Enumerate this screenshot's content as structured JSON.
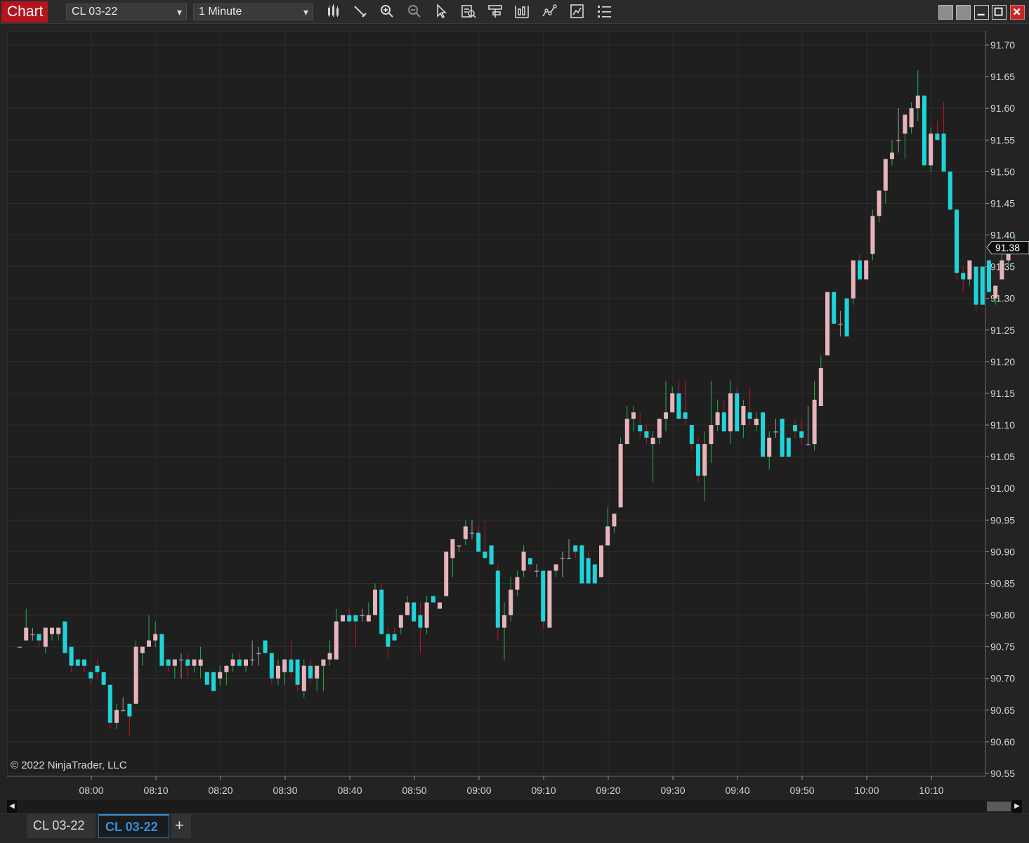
{
  "window": {
    "title": "Chart",
    "instrument": "CL 03-22",
    "interval": "1 Minute",
    "toolbar_icons": [
      "bars-type-icon",
      "drawing-tool-icon",
      "zoom-in-icon",
      "zoom-out-icon",
      "pointer-icon",
      "data-box-icon",
      "properties-icon",
      "strategies-icon",
      "indicators-icon",
      "templates-icon",
      "list-icon"
    ]
  },
  "copyright": "© 2022 NinjaTrader, LLC",
  "tabs": [
    {
      "label": "CL 03-22"
    },
    {
      "label": "CL 03-22"
    }
  ],
  "add_tab_label": "+",
  "colors": {
    "background": "#232323",
    "up_body": "#e8b4bc",
    "down_body": "#1ed4d8",
    "up_wick": "#22b14c",
    "down_wick": "#c0161e",
    "neutral_wick": "#9a9a9a",
    "grid": "#2e2e2e"
  },
  "chart_data": {
    "type": "candlestick",
    "symbol": "CL 03-22",
    "interval": "1 Minute",
    "y_axis": {
      "min": 90.55,
      "max": 91.7,
      "ticks": [
        "90.55",
        "90.60",
        "90.65",
        "90.70",
        "90.75",
        "90.80",
        "90.85",
        "90.90",
        "90.95",
        "91.00",
        "91.05",
        "91.10",
        "91.15",
        "91.20",
        "91.25",
        "91.30",
        "91.35",
        "91.40",
        "91.45",
        "91.50",
        "91.55",
        "91.60",
        "91.65",
        "91.70"
      ]
    },
    "x_axis": {
      "labels": [
        "08:00",
        "08:10",
        "08:20",
        "08:30",
        "08:40",
        "08:50",
        "09:00",
        "09:10",
        "09:20",
        "09:30",
        "09:40",
        "09:50",
        "10:00",
        "10:10"
      ]
    },
    "last_price": "91.38",
    "grid": true,
    "candles": [
      {
        "o": 90.75,
        "h": 90.75,
        "l": 90.75,
        "c": 90.75
      },
      {
        "o": 90.76,
        "h": 90.81,
        "l": 90.76,
        "c": 90.78
      },
      {
        "o": 90.77,
        "h": 90.78,
        "l": 90.76,
        "c": 90.77
      },
      {
        "o": 90.77,
        "h": 90.77,
        "l": 90.75,
        "c": 90.76
      },
      {
        "o": 90.75,
        "h": 90.78,
        "l": 90.74,
        "c": 90.78
      },
      {
        "o": 90.77,
        "h": 90.78,
        "l": 90.76,
        "c": 90.78
      },
      {
        "o": 90.77,
        "h": 90.78,
        "l": 90.76,
        "c": 90.78
      },
      {
        "o": 90.79,
        "h": 90.79,
        "l": 90.74,
        "c": 90.74
      },
      {
        "o": 90.75,
        "h": 90.75,
        "l": 90.71,
        "c": 90.72
      },
      {
        "o": 90.73,
        "h": 90.73,
        "l": 90.72,
        "c": 90.72
      },
      {
        "o": 90.73,
        "h": 90.73,
        "l": 90.71,
        "c": 90.72
      },
      {
        "o": 90.71,
        "h": 90.71,
        "l": 90.69,
        "c": 90.7
      },
      {
        "o": 90.72,
        "h": 90.73,
        "l": 90.7,
        "c": 90.71
      },
      {
        "o": 90.71,
        "h": 90.71,
        "l": 90.69,
        "c": 90.69
      },
      {
        "o": 90.69,
        "h": 90.69,
        "l": 90.62,
        "c": 90.63
      },
      {
        "o": 90.63,
        "h": 90.66,
        "l": 90.62,
        "c": 90.65
      },
      {
        "o": 90.65,
        "h": 90.67,
        "l": 90.65,
        "c": 90.65
      },
      {
        "o": 90.66,
        "h": 90.66,
        "l": 90.61,
        "c": 90.64
      },
      {
        "o": 90.66,
        "h": 90.76,
        "l": 90.66,
        "c": 90.75
      },
      {
        "o": 90.74,
        "h": 90.75,
        "l": 90.72,
        "c": 90.75
      },
      {
        "o": 90.75,
        "h": 90.8,
        "l": 90.75,
        "c": 90.76
      },
      {
        "o": 90.76,
        "h": 90.79,
        "l": 90.75,
        "c": 90.77
      },
      {
        "o": 90.77,
        "h": 90.77,
        "l": 90.72,
        "c": 90.72
      },
      {
        "o": 90.73,
        "h": 90.73,
        "l": 90.71,
        "c": 90.72
      },
      {
        "o": 90.72,
        "h": 90.73,
        "l": 90.7,
        "c": 90.73
      },
      {
        "o": 90.73,
        "h": 90.74,
        "l": 90.7,
        "c": 90.73
      },
      {
        "o": 90.73,
        "h": 90.74,
        "l": 90.7,
        "c": 90.72
      },
      {
        "o": 90.72,
        "h": 90.73,
        "l": 90.71,
        "c": 90.73
      },
      {
        "o": 90.72,
        "h": 90.75,
        "l": 90.7,
        "c": 90.73
      },
      {
        "o": 90.71,
        "h": 90.71,
        "l": 90.69,
        "c": 90.69
      },
      {
        "o": 90.71,
        "h": 90.71,
        "l": 90.68,
        "c": 90.68
      },
      {
        "o": 90.7,
        "h": 90.72,
        "l": 90.69,
        "c": 90.71
      },
      {
        "o": 90.71,
        "h": 90.72,
        "l": 90.69,
        "c": 90.72
      },
      {
        "o": 90.72,
        "h": 90.74,
        "l": 90.71,
        "c": 90.73
      },
      {
        "o": 90.73,
        "h": 90.74,
        "l": 90.72,
        "c": 90.72
      },
      {
        "o": 90.72,
        "h": 90.73,
        "l": 90.71,
        "c": 90.73
      },
      {
        "o": 90.73,
        "h": 90.76,
        "l": 90.72,
        "c": 90.73
      },
      {
        "o": 90.74,
        "h": 90.75,
        "l": 90.72,
        "c": 90.74
      },
      {
        "o": 90.76,
        "h": 90.76,
        "l": 90.74,
        "c": 90.74
      },
      {
        "o": 90.74,
        "h": 90.74,
        "l": 90.69,
        "c": 90.7
      },
      {
        "o": 90.7,
        "h": 90.73,
        "l": 90.69,
        "c": 90.72
      },
      {
        "o": 90.71,
        "h": 90.73,
        "l": 90.69,
        "c": 90.73
      },
      {
        "o": 90.73,
        "h": 90.76,
        "l": 90.7,
        "c": 90.71
      },
      {
        "o": 90.73,
        "h": 90.73,
        "l": 90.68,
        "c": 90.69
      },
      {
        "o": 90.68,
        "h": 90.73,
        "l": 90.67,
        "c": 90.72
      },
      {
        "o": 90.72,
        "h": 90.73,
        "l": 90.69,
        "c": 90.7
      },
      {
        "o": 90.7,
        "h": 90.72,
        "l": 90.68,
        "c": 90.72
      },
      {
        "o": 90.72,
        "h": 90.73,
        "l": 90.68,
        "c": 90.73
      },
      {
        "o": 90.73,
        "h": 90.76,
        "l": 90.72,
        "c": 90.74
      },
      {
        "o": 90.73,
        "h": 90.81,
        "l": 90.73,
        "c": 90.79
      },
      {
        "o": 90.79,
        "h": 90.8,
        "l": 90.79,
        "c": 90.8
      },
      {
        "o": 90.8,
        "h": 90.81,
        "l": 90.79,
        "c": 90.79
      },
      {
        "o": 90.8,
        "h": 90.8,
        "l": 90.75,
        "c": 90.79
      },
      {
        "o": 90.8,
        "h": 90.81,
        "l": 90.79,
        "c": 90.8
      },
      {
        "o": 90.79,
        "h": 90.82,
        "l": 90.79,
        "c": 90.8
      },
      {
        "o": 90.8,
        "h": 90.85,
        "l": 90.8,
        "c": 90.84
      },
      {
        "o": 90.84,
        "h": 90.85,
        "l": 90.77,
        "c": 90.77
      },
      {
        "o": 90.77,
        "h": 90.78,
        "l": 90.73,
        "c": 90.75
      },
      {
        "o": 90.77,
        "h": 90.78,
        "l": 90.76,
        "c": 90.76
      },
      {
        "o": 90.78,
        "h": 90.8,
        "l": 90.77,
        "c": 90.8
      },
      {
        "o": 90.8,
        "h": 90.83,
        "l": 90.8,
        "c": 90.82
      },
      {
        "o": 90.82,
        "h": 90.82,
        "l": 90.79,
        "c": 90.79
      },
      {
        "o": 90.8,
        "h": 90.82,
        "l": 90.74,
        "c": 90.78
      },
      {
        "o": 90.78,
        "h": 90.83,
        "l": 90.77,
        "c": 90.82
      },
      {
        "o": 90.83,
        "h": 90.83,
        "l": 90.82,
        "c": 90.82
      },
      {
        "o": 90.81,
        "h": 90.82,
        "l": 90.81,
        "c": 90.82
      },
      {
        "o": 90.83,
        "h": 90.9,
        "l": 90.83,
        "c": 90.9
      },
      {
        "o": 90.89,
        "h": 90.91,
        "l": 90.86,
        "c": 90.92
      },
      {
        "o": 90.91,
        "h": 90.91,
        "l": 90.9,
        "c": 90.91
      },
      {
        "o": 90.92,
        "h": 90.95,
        "l": 90.91,
        "c": 90.94
      },
      {
        "o": 90.93,
        "h": 90.95,
        "l": 90.92,
        "c": 90.93
      },
      {
        "o": 90.93,
        "h": 90.94,
        "l": 90.9,
        "c": 90.9
      },
      {
        "o": 90.9,
        "h": 90.95,
        "l": 90.89,
        "c": 90.89
      },
      {
        "o": 90.91,
        "h": 90.91,
        "l": 90.88,
        "c": 90.88
      },
      {
        "o": 90.87,
        "h": 90.88,
        "l": 90.76,
        "c": 90.78
      },
      {
        "o": 90.78,
        "h": 90.82,
        "l": 90.73,
        "c": 90.8
      },
      {
        "o": 90.8,
        "h": 90.86,
        "l": 90.79,
        "c": 90.84
      },
      {
        "o": 90.84,
        "h": 90.87,
        "l": 90.83,
        "c": 90.86
      },
      {
        "o": 90.87,
        "h": 90.91,
        "l": 90.86,
        "c": 90.9
      },
      {
        "o": 90.89,
        "h": 90.89,
        "l": 90.87,
        "c": 90.88
      },
      {
        "o": 90.87,
        "h": 90.88,
        "l": 90.86,
        "c": 90.87
      },
      {
        "o": 90.87,
        "h": 90.87,
        "l": 90.78,
        "c": 90.79
      },
      {
        "o": 90.78,
        "h": 90.87,
        "l": 90.78,
        "c": 90.87
      },
      {
        "o": 90.87,
        "h": 90.88,
        "l": 90.86,
        "c": 90.88
      },
      {
        "o": 90.89,
        "h": 90.9,
        "l": 90.86,
        "c": 90.89
      },
      {
        "o": 90.89,
        "h": 90.92,
        "l": 90.89,
        "c": 90.89
      },
      {
        "o": 90.91,
        "h": 90.91,
        "l": 90.89,
        "c": 90.9
      },
      {
        "o": 90.91,
        "h": 90.91,
        "l": 90.85,
        "c": 90.85
      },
      {
        "o": 90.89,
        "h": 90.9,
        "l": 90.85,
        "c": 90.85
      },
      {
        "o": 90.88,
        "h": 90.88,
        "l": 90.85,
        "c": 90.85
      },
      {
        "o": 90.86,
        "h": 90.91,
        "l": 90.86,
        "c": 90.91
      },
      {
        "o": 90.91,
        "h": 90.97,
        "l": 90.91,
        "c": 90.94
      },
      {
        "o": 90.94,
        "h": 90.96,
        "l": 90.93,
        "c": 90.96
      },
      {
        "o": 90.97,
        "h": 91.08,
        "l": 90.97,
        "c": 91.07
      },
      {
        "o": 91.07,
        "h": 91.13,
        "l": 91.07,
        "c": 91.11
      },
      {
        "o": 91.11,
        "h": 91.13,
        "l": 91.09,
        "c": 91.12
      },
      {
        "o": 91.1,
        "h": 91.12,
        "l": 91.08,
        "c": 91.09
      },
      {
        "o": 91.09,
        "h": 91.1,
        "l": 91.07,
        "c": 91.08
      },
      {
        "o": 91.07,
        "h": 91.09,
        "l": 91.01,
        "c": 91.08
      },
      {
        "o": 91.08,
        "h": 91.1,
        "l": 91.07,
        "c": 91.11
      },
      {
        "o": 91.11,
        "h": 91.17,
        "l": 91.09,
        "c": 91.12
      },
      {
        "o": 91.12,
        "h": 91.16,
        "l": 91.12,
        "c": 91.15
      },
      {
        "o": 91.15,
        "h": 91.17,
        "l": 91.11,
        "c": 91.11
      },
      {
        "o": 91.12,
        "h": 91.17,
        "l": 91.1,
        "c": 91.11
      },
      {
        "o": 91.1,
        "h": 91.1,
        "l": 91.06,
        "c": 91.07
      },
      {
        "o": 91.07,
        "h": 91.08,
        "l": 91.01,
        "c": 91.02
      },
      {
        "o": 91.02,
        "h": 91.09,
        "l": 90.98,
        "c": 91.07
      },
      {
        "o": 91.07,
        "h": 91.17,
        "l": 91.04,
        "c": 91.1
      },
      {
        "o": 91.1,
        "h": 91.14,
        "l": 91.09,
        "c": 91.12
      },
      {
        "o": 91.12,
        "h": 91.14,
        "l": 91.09,
        "c": 91.09
      },
      {
        "o": 91.09,
        "h": 91.17,
        "l": 91.07,
        "c": 91.15
      },
      {
        "o": 91.15,
        "h": 91.16,
        "l": 91.09,
        "c": 91.09
      },
      {
        "o": 91.1,
        "h": 91.14,
        "l": 91.08,
        "c": 91.13
      },
      {
        "o": 91.12,
        "h": 91.16,
        "l": 91.1,
        "c": 91.11
      },
      {
        "o": 91.1,
        "h": 91.12,
        "l": 91.09,
        "c": 91.11
      },
      {
        "o": 91.12,
        "h": 91.12,
        "l": 91.05,
        "c": 91.05
      },
      {
        "o": 91.05,
        "h": 91.09,
        "l": 91.03,
        "c": 91.08
      },
      {
        "o": 91.09,
        "h": 91.11,
        "l": 91.08,
        "c": 91.09
      },
      {
        "o": 91.11,
        "h": 91.11,
        "l": 91.05,
        "c": 91.05
      },
      {
        "o": 91.08,
        "h": 91.08,
        "l": 91.05,
        "c": 91.05
      },
      {
        "o": 91.1,
        "h": 91.11,
        "l": 91.08,
        "c": 91.09
      },
      {
        "o": 91.09,
        "h": 91.11,
        "l": 91.07,
        "c": 91.08
      },
      {
        "o": 91.07,
        "h": 91.13,
        "l": 91.07,
        "c": 91.07
      },
      {
        "o": 91.07,
        "h": 91.17,
        "l": 91.06,
        "c": 91.14
      },
      {
        "o": 91.13,
        "h": 91.21,
        "l": 91.13,
        "c": 91.19
      },
      {
        "o": 91.21,
        "h": 91.31,
        "l": 91.21,
        "c": 91.31
      },
      {
        "o": 91.31,
        "h": 91.31,
        "l": 91.26,
        "c": 91.26
      },
      {
        "o": 91.26,
        "h": 91.28,
        "l": 91.24,
        "c": 91.26
      },
      {
        "o": 91.3,
        "h": 91.3,
        "l": 91.24,
        "c": 91.24
      },
      {
        "o": 91.3,
        "h": 91.36,
        "l": 91.29,
        "c": 91.36
      },
      {
        "o": 91.36,
        "h": 91.37,
        "l": 91.33,
        "c": 91.33
      },
      {
        "o": 91.33,
        "h": 91.36,
        "l": 91.33,
        "c": 91.36
      },
      {
        "o": 91.37,
        "h": 91.44,
        "l": 91.36,
        "c": 91.43
      },
      {
        "o": 91.43,
        "h": 91.47,
        "l": 91.42,
        "c": 91.47
      },
      {
        "o": 91.47,
        "h": 91.5,
        "l": 91.45,
        "c": 91.52
      },
      {
        "o": 91.52,
        "h": 91.55,
        "l": 91.51,
        "c": 91.53
      },
      {
        "o": 91.55,
        "h": 91.6,
        "l": 91.53,
        "c": 91.55
      },
      {
        "o": 91.56,
        "h": 91.58,
        "l": 91.52,
        "c": 91.59
      },
      {
        "o": 91.57,
        "h": 91.61,
        "l": 91.56,
        "c": 91.6
      },
      {
        "o": 91.6,
        "h": 91.66,
        "l": 91.58,
        "c": 91.62
      },
      {
        "o": 91.62,
        "h": 91.62,
        "l": 91.51,
        "c": 91.51
      },
      {
        "o": 91.51,
        "h": 91.57,
        "l": 91.5,
        "c": 91.56
      },
      {
        "o": 91.56,
        "h": 91.58,
        "l": 91.55,
        "c": 91.55
      },
      {
        "o": 91.56,
        "h": 91.61,
        "l": 91.5,
        "c": 91.5
      },
      {
        "o": 91.5,
        "h": 91.5,
        "l": 91.44,
        "c": 91.44
      },
      {
        "o": 91.44,
        "h": 91.44,
        "l": 91.33,
        "c": 91.34
      },
      {
        "o": 91.34,
        "h": 91.35,
        "l": 91.31,
        "c": 91.33
      },
      {
        "o": 91.33,
        "h": 91.36,
        "l": 91.32,
        "c": 91.36
      },
      {
        "o": 91.35,
        "h": 91.35,
        "l": 91.28,
        "c": 91.29
      },
      {
        "o": 91.35,
        "h": 91.35,
        "l": 91.29,
        "c": 91.29
      },
      {
        "o": 91.36,
        "h": 91.36,
        "l": 91.31,
        "c": 91.31
      },
      {
        "o": 91.3,
        "h": 91.32,
        "l": 91.29,
        "c": 91.32
      },
      {
        "o": 91.33,
        "h": 91.37,
        "l": 91.33,
        "c": 91.36
      },
      {
        "o": 91.36,
        "h": 91.38,
        "l": 91.35,
        "c": 91.37
      },
      {
        "o": 91.37,
        "h": 91.4,
        "l": 91.37,
        "c": 91.38
      }
    ]
  }
}
